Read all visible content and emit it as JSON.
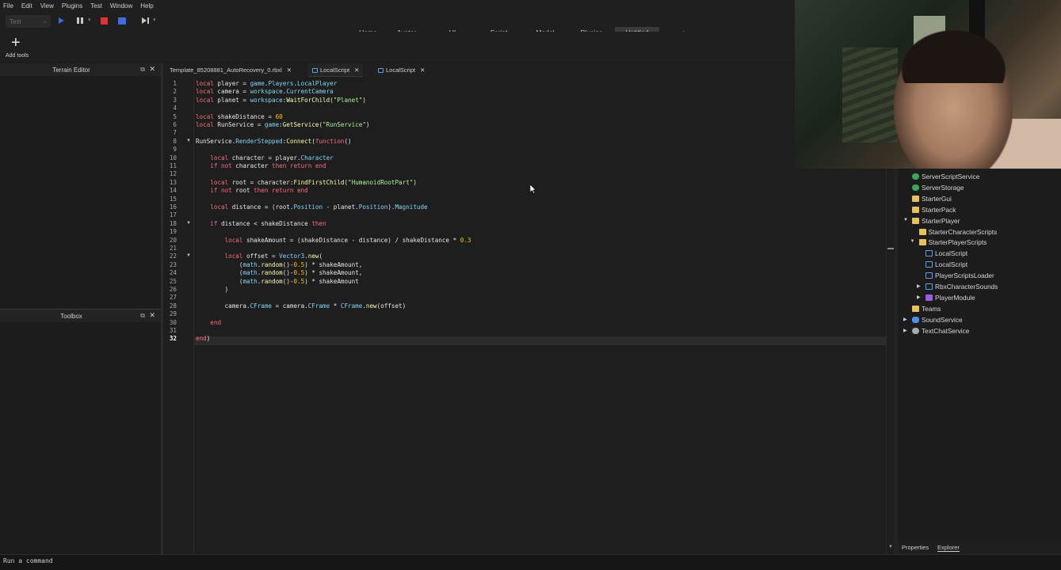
{
  "menu": [
    "File",
    "Edit",
    "View",
    "Plugins",
    "Test",
    "Window",
    "Help"
  ],
  "toolbar": {
    "test_mode": "Test",
    "tabs": [
      "Home",
      "Avatar",
      "UI",
      "Script",
      "Model",
      "Plugins",
      "Untitled",
      "+"
    ],
    "add_tools_label": "Add tools"
  },
  "panels": {
    "terrain_editor": "Terrain Editor",
    "toolbox": "Toolbox"
  },
  "editor_tabs": [
    {
      "label": "Template_85208881_AutoRecovery_0.rbxl"
    },
    {
      "label": "LocalScript"
    },
    {
      "label": "LocalScript"
    }
  ],
  "current_line": 32,
  "code": [
    [
      [
        "kw",
        "local"
      ],
      [
        "",
        " player = "
      ],
      [
        "ply",
        "game"
      ],
      [
        "",
        "."
      ],
      [
        "ply",
        "Players"
      ],
      [
        "",
        "."
      ],
      [
        "ply",
        "LocalPlayer"
      ]
    ],
    [
      [
        "kw",
        "local"
      ],
      [
        "",
        " camera = "
      ],
      [
        "ply",
        "workspace"
      ],
      [
        "",
        "."
      ],
      [
        "ply",
        "CurrentCamera"
      ]
    ],
    [
      [
        "kw",
        "local"
      ],
      [
        "",
        " planet = "
      ],
      [
        "ply",
        "workspace"
      ],
      [
        "",
        ":"
      ],
      [
        "fn",
        "WaitForChild"
      ],
      [
        "",
        "("
      ],
      [
        "str",
        "\"Planet\""
      ],
      [
        "",
        ")"
      ]
    ],
    [],
    [
      [
        "kw",
        "local"
      ],
      [
        "",
        " shakeDistance = "
      ],
      [
        "num",
        "60"
      ]
    ],
    [
      [
        "kw",
        "local"
      ],
      [
        "",
        " RunService = "
      ],
      [
        "ply",
        "game"
      ],
      [
        "",
        ":"
      ],
      [
        "fn",
        "GetService"
      ],
      [
        "",
        "("
      ],
      [
        "str",
        "\"RunService\""
      ],
      [
        "",
        ")"
      ]
    ],
    [],
    [
      [
        "",
        "RunService."
      ],
      [
        "ply",
        "RenderStepped"
      ],
      [
        "",
        ":"
      ],
      [
        "fn",
        "Connect"
      ],
      [
        "",
        "("
      ],
      [
        "kw",
        "function"
      ],
      [
        "",
        "()"
      ]
    ],
    [],
    [
      [
        "",
        "    "
      ],
      [
        "kw",
        "local"
      ],
      [
        "",
        " character = player."
      ],
      [
        "ply",
        "Character"
      ]
    ],
    [
      [
        "",
        "    "
      ],
      [
        "kw",
        "if not"
      ],
      [
        "",
        " character "
      ],
      [
        "kw",
        "then return end"
      ]
    ],
    [],
    [
      [
        "",
        "    "
      ],
      [
        "kw",
        "local"
      ],
      [
        "",
        " root = character:"
      ],
      [
        "fn",
        "FindFirstChild"
      ],
      [
        "",
        "("
      ],
      [
        "str",
        "\"HumanoidRootPart\""
      ],
      [
        "",
        ")"
      ]
    ],
    [
      [
        "",
        "    "
      ],
      [
        "kw",
        "if not"
      ],
      [
        "",
        " root "
      ],
      [
        "kw",
        "then return end"
      ]
    ],
    [],
    [
      [
        "",
        "    "
      ],
      [
        "kw",
        "local"
      ],
      [
        "",
        " distance = (root."
      ],
      [
        "ply",
        "Position"
      ],
      [
        "",
        " - planet."
      ],
      [
        "ply",
        "Position"
      ],
      [
        "",
        ")."
      ],
      [
        "ply",
        "Magnitude"
      ]
    ],
    [],
    [
      [
        "",
        "    "
      ],
      [
        "kw",
        "if"
      ],
      [
        "",
        " distance < shakeDistance "
      ],
      [
        "kw",
        "then"
      ]
    ],
    [],
    [
      [
        "",
        "        "
      ],
      [
        "kw",
        "local"
      ],
      [
        "",
        " shakeAmount = (shakeDistance - distance) / shakeDistance * "
      ],
      [
        "num",
        "0.3"
      ]
    ],
    [],
    [
      [
        "",
        "        "
      ],
      [
        "kw",
        "local"
      ],
      [
        "",
        " offset = "
      ],
      [
        "bi",
        "Vector3"
      ],
      [
        "",
        "."
      ],
      [
        "fn",
        "new"
      ],
      [
        "",
        "("
      ]
    ],
    [
      [
        "",
        "            ("
      ],
      [
        "bi",
        "math"
      ],
      [
        "",
        "."
      ],
      [
        "fn",
        "random"
      ],
      [
        "",
        "()-"
      ],
      [
        "num",
        "0.5"
      ],
      [
        "",
        ") * shakeAmount,"
      ]
    ],
    [
      [
        "",
        "            ("
      ],
      [
        "bi",
        "math"
      ],
      [
        "",
        "."
      ],
      [
        "fn",
        "random"
      ],
      [
        "",
        "()-"
      ],
      [
        "num",
        "0.5"
      ],
      [
        "",
        ") * shakeAmount,"
      ]
    ],
    [
      [
        "",
        "            ("
      ],
      [
        "bi",
        "math"
      ],
      [
        "",
        "."
      ],
      [
        "fn",
        "random"
      ],
      [
        "",
        "()-"
      ],
      [
        "num",
        "0.5"
      ],
      [
        "",
        ") * shakeAmount"
      ]
    ],
    [
      [
        "",
        "        )"
      ]
    ],
    [],
    [
      [
        "",
        "        camera."
      ],
      [
        "ply",
        "CFrame"
      ],
      [
        "",
        " = camera."
      ],
      [
        "ply",
        "CFrame"
      ],
      [
        "",
        " * "
      ],
      [
        "bi",
        "CFrame"
      ],
      [
        "",
        "."
      ],
      [
        "fn",
        "new"
      ],
      [
        "",
        "(offset)"
      ]
    ],
    [],
    [
      [
        "",
        "    "
      ],
      [
        "kw",
        "end"
      ]
    ],
    [],
    [
      [
        "kw",
        "end"
      ],
      [
        "",
        ")"
      ]
    ]
  ],
  "explorer": {
    "items": [
      {
        "label": "ServerScriptService",
        "icon": "green"
      },
      {
        "label": "ServerStorage",
        "icon": "green"
      },
      {
        "label": "StarterGui",
        "icon": "folder"
      },
      {
        "label": "StarterPack",
        "icon": "folder"
      },
      {
        "label": "StarterPlayer",
        "icon": "folder"
      },
      {
        "label": "StarterCharacterScripts",
        "icon": "folder"
      },
      {
        "label": "StarterPlayerScripts",
        "icon": "folder"
      },
      {
        "label": "LocalScript",
        "icon": "script"
      },
      {
        "label": "LocalScript",
        "icon": "script"
      },
      {
        "label": "PlayerScriptsLoader",
        "icon": "script"
      },
      {
        "label": "RbxCharacterSounds",
        "icon": "script"
      },
      {
        "label": "PlayerModule",
        "icon": "purple"
      },
      {
        "label": "Teams",
        "icon": "folder"
      },
      {
        "label": "SoundService",
        "icon": "blue"
      },
      {
        "label": "TextChatService",
        "icon": "gear"
      }
    ],
    "bottom_tabs": [
      "Properties",
      "Explorer"
    ]
  },
  "status": {
    "command_placeholder": "Run a command"
  }
}
